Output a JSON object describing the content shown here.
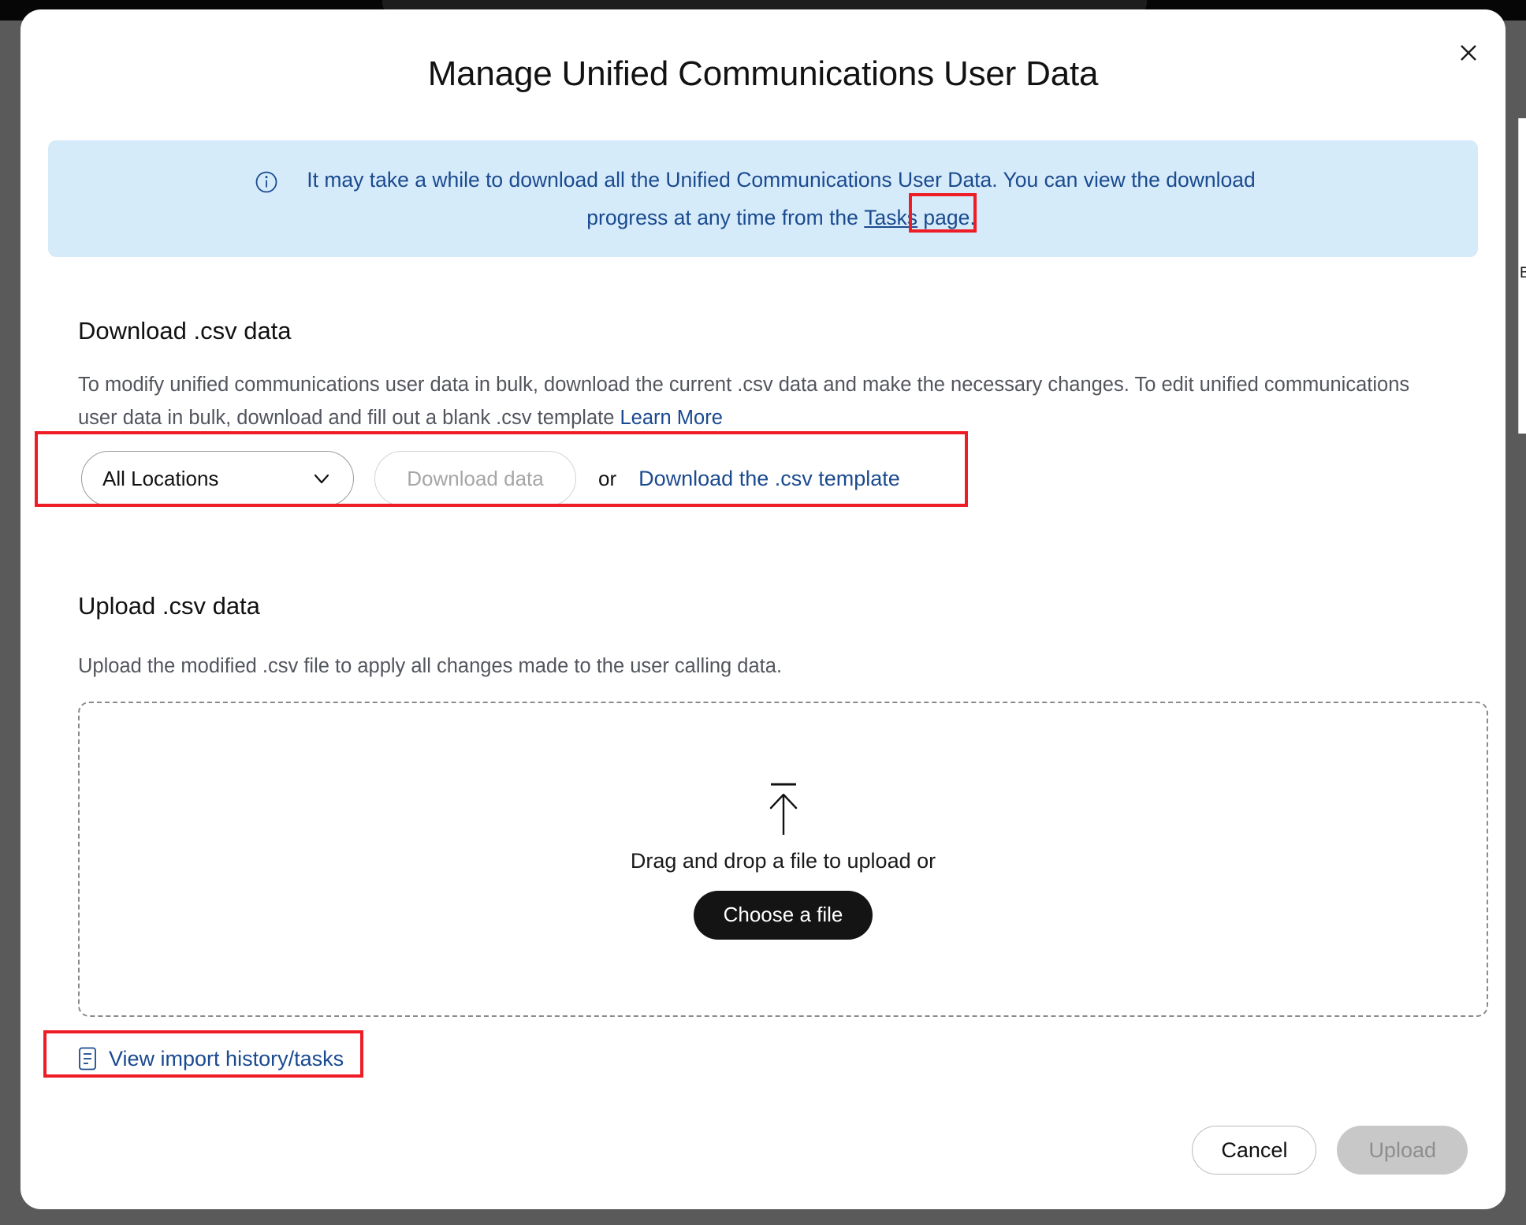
{
  "modal": {
    "title": "Manage Unified Communications User Data",
    "close_icon": "close-icon"
  },
  "banner": {
    "icon": "info-circle-icon",
    "text_before_link": "It may take a while to download all the Unified Communications User Data. You can view the download progress at any time from the ",
    "link_label": "Tasks",
    "text_after_link": " page.",
    "background_color": "#d6ebfa",
    "text_color": "#1a4a8f"
  },
  "download_section": {
    "title": "Download .csv data",
    "description": "To modify unified communications user data in bulk, download the current .csv data and make the necessary changes. To edit unified communications user data in bulk, download and fill out a blank .csv template ",
    "learn_more_label": "Learn More",
    "location_select_value": "All Locations",
    "location_select_icon": "chevron-down-icon",
    "download_data_label": "Download data",
    "or_label": "or",
    "download_template_label": "Download the .csv template"
  },
  "upload_section": {
    "title": "Upload .csv data",
    "description": "Upload the modified .csv file to apply all changes made to the user calling data.",
    "dropzone_icon": "upload-arrow-icon",
    "dropzone_text": "Drag and drop a file to upload or",
    "choose_file_label": "Choose a file"
  },
  "import_history": {
    "icon": "document-list-icon",
    "label": "View import history/tasks"
  },
  "footer": {
    "cancel_label": "Cancel",
    "upload_label": "Upload"
  },
  "highlights": {
    "accent_color": "#ee1c25"
  },
  "edge": {
    "sliver_text": "B"
  }
}
